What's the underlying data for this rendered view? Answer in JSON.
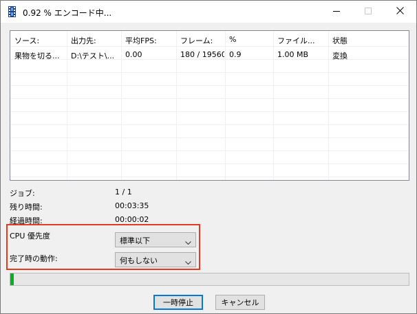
{
  "window": {
    "title": "0.92 % エンコード中...",
    "icon": "film-strip-icon"
  },
  "title_buttons": {
    "minimize_icon": "minimize-icon",
    "maximize_icon": "maximize-icon",
    "close_icon": "close-icon"
  },
  "job_list": {
    "columns": [
      "ソース:",
      "出力先:",
      "平均FPS:",
      "フレーム:",
      "%",
      "ファイル...",
      "状態"
    ],
    "rows": [
      [
        "果物を切る...",
        "D:\\テスト\\...",
        "0.00",
        "180 / 19560",
        "0.9",
        "1.00 MB",
        "変換"
      ]
    ]
  },
  "info": {
    "job_label": "ジョブ:",
    "job_value": "1 / 1",
    "remaining_label": "残り時間:",
    "remaining_value": "00:03:35",
    "elapsed_label": "経過時間:",
    "elapsed_value": "00:00:02"
  },
  "settings": {
    "cpu_priority_label": "CPU 優先度",
    "cpu_priority_value": "標準以下",
    "on_complete_label": "完了時の動作:",
    "on_complete_value": "何もしない"
  },
  "progress": {
    "fraction": 0.0092
  },
  "buttons": {
    "pause_label": "一時停止",
    "cancel_label": "キャンセル"
  },
  "colors": {
    "highlight_border": "#e53a1e",
    "progress_fill": "#06b025",
    "focus_border": "#0078d7"
  }
}
